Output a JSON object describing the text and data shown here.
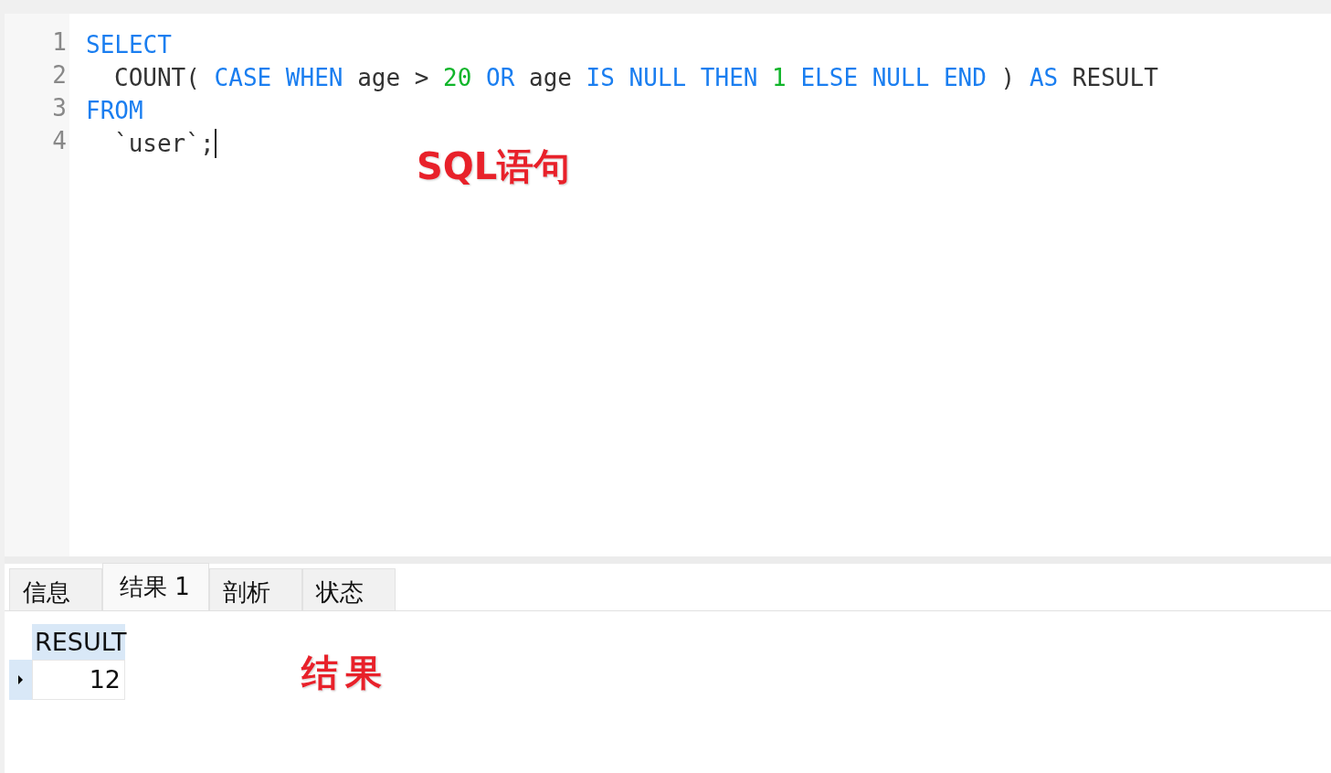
{
  "editor": {
    "lines": [
      {
        "number": "1",
        "indent": false,
        "tokens": [
          {
            "kind": "keyword",
            "text": "SELECT"
          }
        ]
      },
      {
        "number": "2",
        "indent": true,
        "tokens": [
          {
            "kind": "plain",
            "text": "COUNT( "
          },
          {
            "kind": "keyword",
            "text": "CASE WHEN "
          },
          {
            "kind": "plain",
            "text": "age > "
          },
          {
            "kind": "number",
            "text": "20"
          },
          {
            "kind": "keyword",
            "text": " OR "
          },
          {
            "kind": "plain",
            "text": "age "
          },
          {
            "kind": "keyword",
            "text": "IS NULL THEN "
          },
          {
            "kind": "number",
            "text": "1"
          },
          {
            "kind": "keyword",
            "text": " ELSE NULL END "
          },
          {
            "kind": "plain",
            "text": ") "
          },
          {
            "kind": "keyword",
            "text": "AS "
          },
          {
            "kind": "plain",
            "text": "RESULT"
          }
        ]
      },
      {
        "number": "3",
        "indent": false,
        "tokens": [
          {
            "kind": "keyword",
            "text": "FROM"
          }
        ]
      },
      {
        "number": "4",
        "indent": true,
        "cursor": true,
        "tokens": [
          {
            "kind": "plain",
            "text": "`user`;"
          }
        ]
      }
    ],
    "annotation": "SQL语句"
  },
  "tabs": [
    {
      "label": "信息",
      "selected": false
    },
    {
      "label": "结果 1",
      "selected": true
    },
    {
      "label": "剖析",
      "selected": false
    },
    {
      "label": "状态",
      "selected": false
    }
  ],
  "result": {
    "columns": [
      "RESULT"
    ],
    "rows": [
      {
        "selected": true,
        "cells": [
          "12"
        ]
      }
    ],
    "annotation": "结果"
  }
}
